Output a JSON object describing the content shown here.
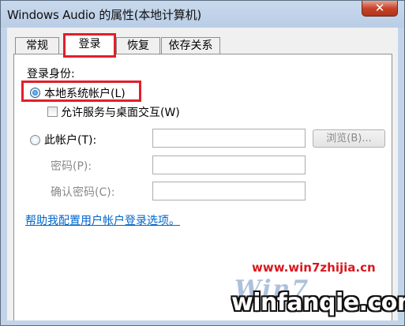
{
  "window": {
    "title": "Windows Audio 的属性(本地计算机)",
    "close_glyph": "✕"
  },
  "tabs": [
    {
      "label": "常规"
    },
    {
      "label": "登录"
    },
    {
      "label": "恢复"
    },
    {
      "label": "依存关系"
    }
  ],
  "active_tab": "登录",
  "logon": {
    "section_label": "登录身份:",
    "local_system_label": "本地系统帐户(L)",
    "local_system_selected": true,
    "allow_desktop_label": "允许服务与桌面交互(W)",
    "allow_desktop_checked": false,
    "this_account_label": "此帐户(T):",
    "this_account_selected": false,
    "this_account_value": "",
    "browse_label": "浏览(B)...",
    "password_label": "密码(P):",
    "password_value": "",
    "confirm_password_label": "确认密码(C):",
    "confirm_password_value": "",
    "help_link": "帮助我配置用户帐户登录选项。"
  },
  "watermark": {
    "url": "www.win7zhijia.cn",
    "logo_text": "Win7",
    "site": "winfanqie.com"
  },
  "colors": {
    "highlight": "#e0202a",
    "link": "#0066cc",
    "watermark_url": "#d8181f"
  }
}
